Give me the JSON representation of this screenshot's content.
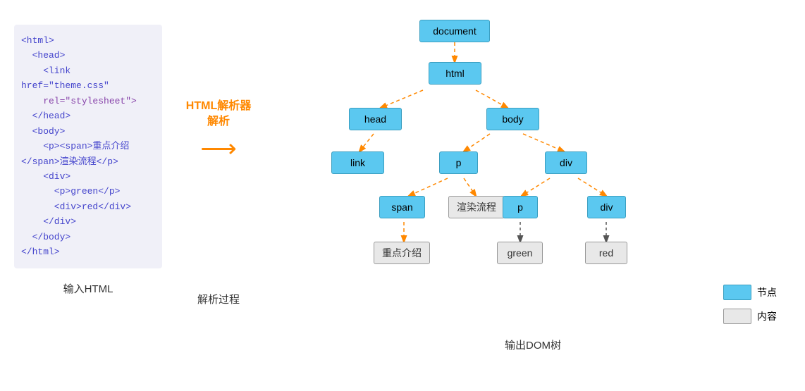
{
  "code": {
    "lines": [
      {
        "text": "<html>",
        "class": "c-blue"
      },
      {
        "text": "  <head>",
        "class": "c-blue"
      },
      {
        "text": "    <link href=\"theme.css\"",
        "class": "c-blue"
      },
      {
        "text": "    rel=\"stylesheet\">",
        "class": "c-purple"
      },
      {
        "text": "  </head>",
        "class": "c-blue"
      },
      {
        "text": "  <body>",
        "class": "c-blue"
      },
      {
        "text": "    <p><span>重点介绍</span>渲染流程</p>",
        "class": "c-blue"
      },
      {
        "text": "    <div>",
        "class": "c-blue"
      },
      {
        "text": "      <p>green</p>",
        "class": "c-blue"
      },
      {
        "text": "      <div>red</div>",
        "class": "c-blue"
      },
      {
        "text": "    </div>",
        "class": "c-blue"
      },
      {
        "text": "  </body>",
        "class": "c-blue"
      },
      {
        "text": "</html>",
        "class": "c-blue"
      }
    ]
  },
  "arrow": {
    "label": "HTML解析器\n解析"
  },
  "labels": {
    "input": "输入HTML",
    "process": "解析过程",
    "output": "输出DOM树"
  },
  "legend": {
    "node_label": "节点",
    "content_label": "内容"
  },
  "nodes": {
    "document": "document",
    "html": "html",
    "head": "head",
    "body": "body",
    "link": "link",
    "p1": "p",
    "div1": "div",
    "span": "span",
    "text_render": "渲染流程",
    "p2": "p",
    "div2": "div",
    "zhongdian": "重点介绍",
    "green": "green",
    "red": "red"
  }
}
